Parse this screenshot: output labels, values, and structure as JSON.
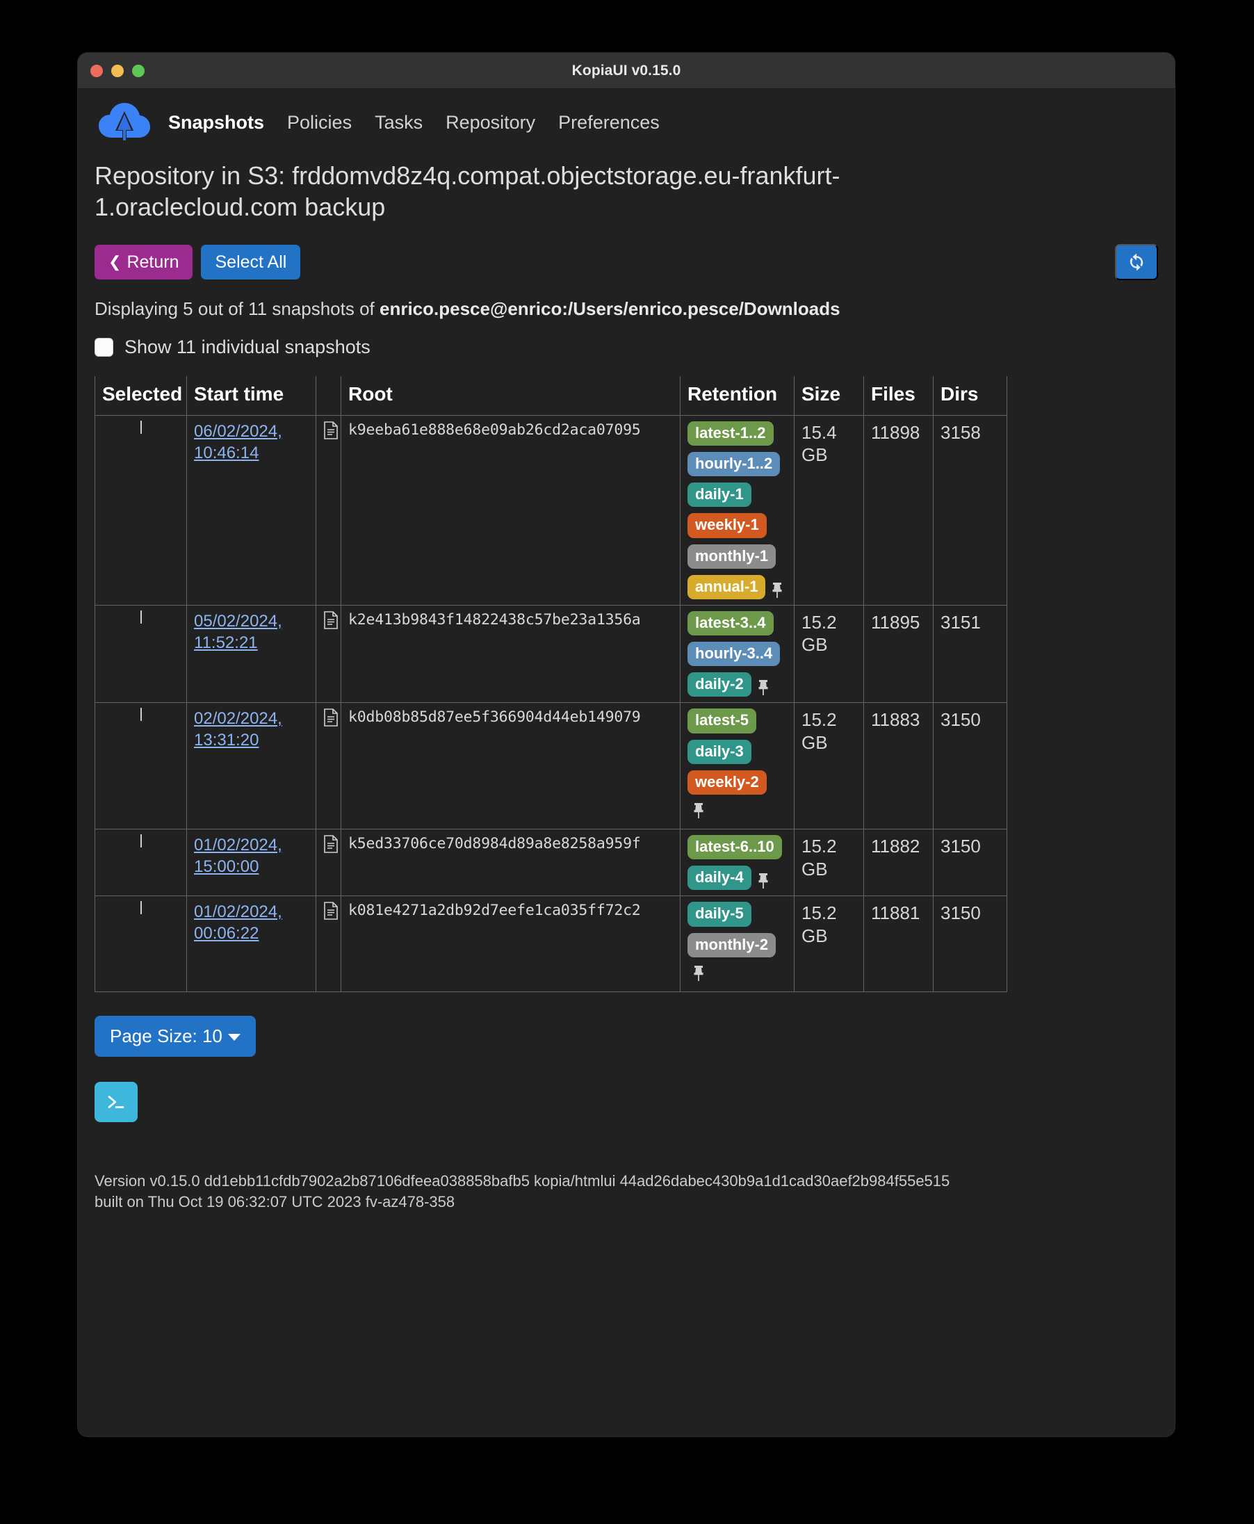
{
  "window": {
    "title": "KopiaUI v0.15.0"
  },
  "nav": {
    "logo_icon": "kopia-cloud-logo",
    "links": [
      {
        "label": "Snapshots",
        "active": true
      },
      {
        "label": "Policies",
        "active": false
      },
      {
        "label": "Tasks",
        "active": false
      },
      {
        "label": "Repository",
        "active": false
      },
      {
        "label": "Preferences",
        "active": false
      }
    ]
  },
  "page": {
    "repo_title": "Repository in S3: frddomvd8z4q.compat.objectstorage.eu-frankfurt-1.oraclecloud.com backup",
    "return_label": "Return",
    "return_icon": "chevron-left-icon",
    "select_all_label": "Select All",
    "refresh_icon": "refresh-icon",
    "displaying_prefix": "Displaying 5 out of 11 snapshots of ",
    "displaying_source": "enrico.pesce@enrico:/Users/enrico.pesce/Downloads",
    "show_individual_label": "Show 11 individual snapshots",
    "show_individual_checked": false,
    "page_size_label": "Page Size: 10",
    "terminal_icon": "terminal-icon",
    "version_line1": "Version v0.15.0 dd1ebb11cfdb7902a2b87106dfeea038858bafb5 kopia/htmlui 44ad26dabec430b9a1d1cad30aef2b984f55e515",
    "version_line2": "built on Thu Oct 19 06:32:07 UTC 2023 fv-az478-358"
  },
  "colors": {
    "accent_blue": "#2272c6",
    "return_purple": "#9b2b8f",
    "terminal_cyan": "#3fb6db",
    "link_blue": "#8cb4f0",
    "badge_latest": "#6c9a4a",
    "badge_hourly": "#5b8db8",
    "badge_daily": "#2f9689",
    "badge_weekly": "#d2591f",
    "badge_monthly": "#8c8c8c",
    "badge_annual": "#d9ab2c"
  },
  "table": {
    "columns": [
      "Selected",
      "Start time",
      "",
      "Root",
      "Retention",
      "Size",
      "Files",
      "Dirs"
    ],
    "rows": [
      {
        "selected": false,
        "start_time": "06/02/2024, 10:46:14",
        "root": "k9eeba61e888e68e09ab26cd2aca07095",
        "retention": [
          {
            "label": "latest-1..2",
            "kind": "latest"
          },
          {
            "label": "hourly-1..2",
            "kind": "hourly"
          },
          {
            "label": "daily-1",
            "kind": "daily"
          },
          {
            "label": "weekly-1",
            "kind": "weekly"
          },
          {
            "label": "monthly-1",
            "kind": "monthly"
          },
          {
            "label": "annual-1",
            "kind": "annual"
          }
        ],
        "pin_after_index": 5,
        "pin_inline": true,
        "size": "15.4 GB",
        "files": "11898",
        "dirs": "3158"
      },
      {
        "selected": false,
        "start_time": "05/02/2024, 11:52:21",
        "root": "k2e413b9843f14822438c57be23a1356a",
        "retention": [
          {
            "label": "latest-3..4",
            "kind": "latest"
          },
          {
            "label": "hourly-3..4",
            "kind": "hourly"
          },
          {
            "label": "daily-2",
            "kind": "daily"
          }
        ],
        "pin_after_index": 2,
        "pin_inline": true,
        "size": "15.2 GB",
        "files": "11895",
        "dirs": "3151"
      },
      {
        "selected": false,
        "start_time": "02/02/2024, 13:31:20",
        "root": "k0db08b85d87ee5f366904d44eb149079",
        "retention": [
          {
            "label": "latest-5",
            "kind": "latest"
          },
          {
            "label": "daily-3",
            "kind": "daily"
          },
          {
            "label": "weekly-2",
            "kind": "weekly"
          }
        ],
        "pin_after_index": 2,
        "pin_inline": false,
        "size": "15.2 GB",
        "files": "11883",
        "dirs": "3150"
      },
      {
        "selected": false,
        "start_time": "01/02/2024, 15:00:00",
        "root": "k5ed33706ce70d8984d89a8e8258a959f",
        "retention": [
          {
            "label": "latest-6..10",
            "kind": "latest"
          },
          {
            "label": "daily-4",
            "kind": "daily"
          }
        ],
        "pin_after_index": 1,
        "pin_inline": true,
        "size": "15.2 GB",
        "files": "11882",
        "dirs": "3150"
      },
      {
        "selected": false,
        "start_time": "01/02/2024, 00:06:22",
        "root": "k081e4271a2db92d7eefe1ca035ff72c2",
        "retention": [
          {
            "label": "daily-5",
            "kind": "daily"
          },
          {
            "label": "monthly-2",
            "kind": "monthly"
          }
        ],
        "pin_after_index": 1,
        "pin_inline": false,
        "size": "15.2 GB",
        "files": "11881",
        "dirs": "3150"
      }
    ]
  }
}
